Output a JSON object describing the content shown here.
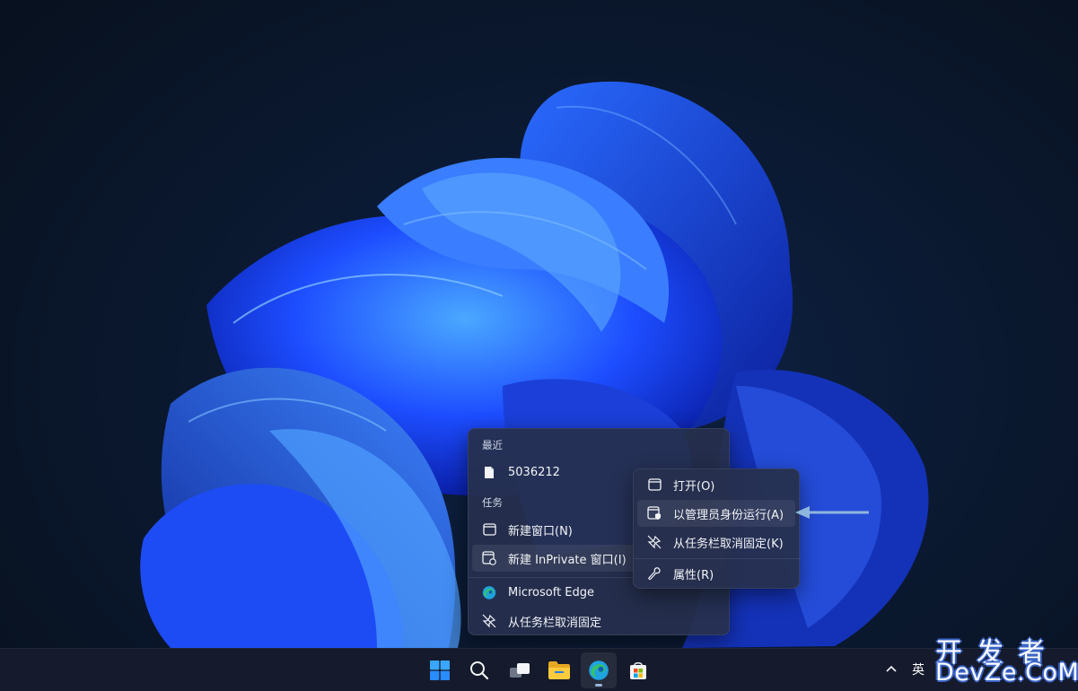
{
  "jumplist": {
    "recent_header": "最近",
    "recent_items": [
      {
        "label": "5036212",
        "icon": "document-icon"
      }
    ],
    "tasks_header": "任务",
    "tasks": [
      {
        "label": "新建窗口(N)",
        "icon": "window-icon"
      },
      {
        "label": "新建 InPrivate 窗口(I)",
        "icon": "inprivate-window-icon"
      }
    ],
    "app": {
      "label": "Microsoft Edge",
      "icon": "edge-icon"
    },
    "unpin": {
      "label": "从任务栏取消固定",
      "icon": "unpin-icon"
    }
  },
  "submenu": {
    "items": [
      {
        "label": "打开(O)",
        "icon": "window-icon"
      },
      {
        "label": "以管理员身份运行(A)",
        "icon": "shield-window-icon"
      },
      {
        "label": "从任务栏取消固定(K)",
        "icon": "unpin-icon"
      },
      {
        "label": "属性(R)",
        "icon": "wrench-icon"
      }
    ]
  },
  "taskbar": {
    "apps": [
      {
        "name": "start",
        "icon": "windows-logo-icon"
      },
      {
        "name": "search",
        "icon": "search-icon"
      },
      {
        "name": "task-view",
        "icon": "task-view-icon"
      },
      {
        "name": "file-explorer",
        "icon": "folder-icon"
      },
      {
        "name": "edge",
        "icon": "edge-icon",
        "active": true
      },
      {
        "name": "store",
        "icon": "store-icon"
      }
    ],
    "tray": {
      "ime": "英"
    }
  },
  "watermark": {
    "line1": "开发者",
    "line2": "DevZe.CoM"
  },
  "colors": {
    "accent": "#1e5cff",
    "menu_bg": "#26304e",
    "arrow": "#8fb6dc"
  }
}
